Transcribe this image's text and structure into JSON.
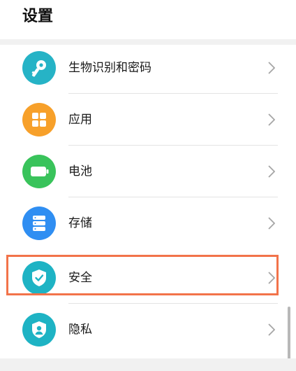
{
  "header": {
    "title": "设置"
  },
  "settings": {
    "items": [
      {
        "label": "生物识别和密码",
        "icon": "key-icon",
        "color": "#26b3c6"
      },
      {
        "label": "应用",
        "icon": "apps-grid-icon",
        "color": "#f7a02a"
      },
      {
        "label": "电池",
        "icon": "battery-icon",
        "color": "#39c35b"
      },
      {
        "label": "存储",
        "icon": "storage-icon",
        "color": "#2f8ef2"
      },
      {
        "label": "安全",
        "icon": "shield-check-icon",
        "color": "#1eb3c4"
      },
      {
        "label": "隐私",
        "icon": "privacy-icon",
        "color": "#1eb3c4"
      }
    ]
  },
  "highlight": {
    "target": "安全",
    "color": "#f2734a"
  }
}
